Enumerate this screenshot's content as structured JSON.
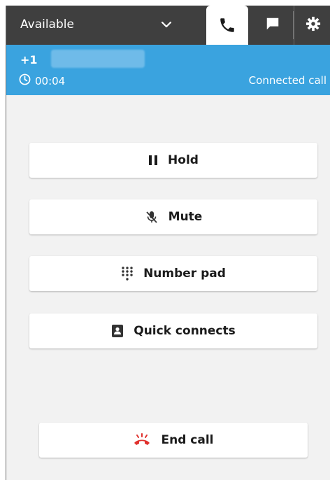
{
  "status_bar": {
    "status_label": "Available",
    "tabs": [
      {
        "name": "phone",
        "icon": "phone-icon",
        "active": true
      },
      {
        "name": "chat",
        "icon": "chat-icon",
        "active": false
      },
      {
        "name": "settings",
        "icon": "gear-icon",
        "active": false
      }
    ]
  },
  "call": {
    "caller_prefix": "+1",
    "timer": "00:04",
    "status": "Connected call"
  },
  "actions": {
    "hold_label": "Hold",
    "mute_label": "Mute",
    "number_pad_label": "Number pad",
    "quick_connects_label": "Quick connects",
    "end_call_label": "End call"
  },
  "colors": {
    "topbar": "#3f3f3f",
    "call_bar": "#3aa3df",
    "panel": "#f2f2f2",
    "end_call_icon": "#e0312d"
  }
}
